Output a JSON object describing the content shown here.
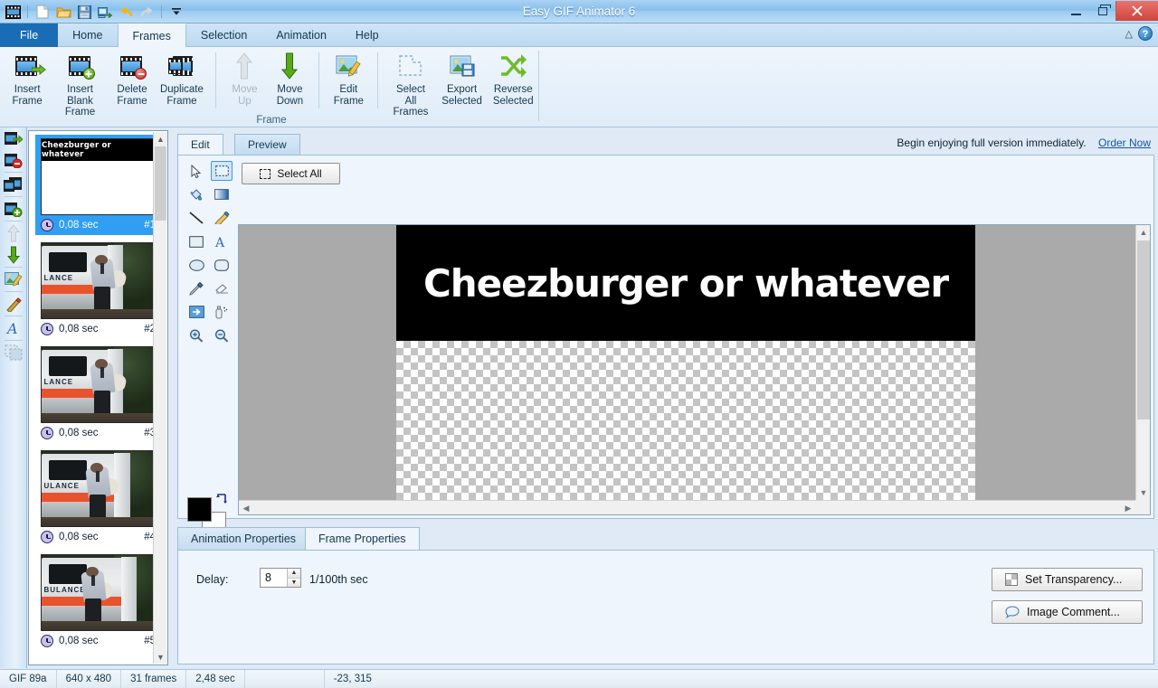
{
  "window": {
    "title": "Easy GIF Animator 6",
    "minimize_label": "Minimize",
    "maximize_label": "Restore",
    "close_label": "Close"
  },
  "quick_access": {
    "items": [
      {
        "name": "app-logo-icon",
        "label": "Easy GIF Animator"
      },
      {
        "name": "new-icon",
        "label": "New"
      },
      {
        "name": "open-icon",
        "label": "Open"
      },
      {
        "name": "save-icon",
        "label": "Save"
      },
      {
        "name": "export-icon",
        "label": "Export"
      },
      {
        "name": "undo-icon",
        "label": "Undo"
      },
      {
        "name": "redo-icon",
        "label": "Redo"
      },
      {
        "name": "customize-icon",
        "label": "Customize Quick Access Toolbar"
      }
    ]
  },
  "ribbon": {
    "tabs": [
      {
        "label": "File",
        "active": false,
        "is_file": true
      },
      {
        "label": "Home",
        "active": false
      },
      {
        "label": "Frames",
        "active": true
      },
      {
        "label": "Selection",
        "active": false
      },
      {
        "label": "Animation",
        "active": false
      },
      {
        "label": "Help",
        "active": false
      }
    ],
    "collapse_label": "Minimize the Ribbon",
    "help_label": "?",
    "group_title": "Frame",
    "buttons": [
      {
        "line1": "Insert",
        "line2": "Frame",
        "icon": "insert-frame-icon",
        "disabled": false
      },
      {
        "line1": "Insert Blank",
        "line2": "Frame",
        "icon": "insert-blank-frame-icon",
        "disabled": false
      },
      {
        "line1": "Delete",
        "line2": "Frame",
        "icon": "delete-frame-icon",
        "disabled": false
      },
      {
        "line1": "Duplicate",
        "line2": "Frame",
        "icon": "duplicate-frame-icon",
        "disabled": false
      },
      {
        "line1": "Move",
        "line2": "Up",
        "icon": "move-up-icon",
        "disabled": true
      },
      {
        "line1": "Move",
        "line2": "Down",
        "icon": "move-down-icon",
        "disabled": false
      },
      {
        "line1": "Edit",
        "line2": "Frame",
        "icon": "edit-frame-icon",
        "disabled": false
      },
      {
        "line1": "Select All",
        "line2": "Frames",
        "icon": "select-all-frames-icon",
        "disabled": false
      },
      {
        "line1": "Export",
        "line2": "Selected",
        "icon": "export-selected-icon",
        "disabled": false
      },
      {
        "line1": "Reverse",
        "line2": "Selected",
        "icon": "reverse-selected-icon",
        "disabled": false
      }
    ]
  },
  "side_toolbar": {
    "items": [
      {
        "name": "insert-frame-icon",
        "label": "Insert Frame"
      },
      {
        "name": "delete-frame-icon",
        "label": "Delete Frame"
      },
      {
        "name": "duplicate-frame-icon",
        "label": "Duplicate Frame"
      },
      {
        "name": "insert-blank-frame-icon",
        "label": "Insert Blank Frame"
      },
      {
        "name": "move-up-icon",
        "label": "Move Up"
      },
      {
        "name": "move-down-icon",
        "label": "Move Down"
      },
      {
        "name": "edit-frame-icon",
        "label": "Edit Frame"
      },
      {
        "name": "magic-wand-icon",
        "label": "Magic Wand"
      },
      {
        "name": "text-tool-icon",
        "label": "Add Text"
      },
      {
        "name": "select-all-frames-icon",
        "label": "Select All Frames"
      }
    ]
  },
  "frames": {
    "scroll_up_label": "Scroll up",
    "scroll_down_label": "Scroll down",
    "items": [
      {
        "delay": "0,08 sec",
        "number": "#1",
        "selected": true,
        "kind": "banner",
        "caption": "Cheezburger or whatever"
      },
      {
        "delay": "0,08 sec",
        "number": "#2",
        "selected": false,
        "kind": "photo",
        "caption": "LANCE"
      },
      {
        "delay": "0,08 sec",
        "number": "#3",
        "selected": false,
        "kind": "photo",
        "caption": "LANCE"
      },
      {
        "delay": "0,08 sec",
        "number": "#4",
        "selected": false,
        "kind": "photo",
        "caption": "ULANCE"
      },
      {
        "delay": "0,08 sec",
        "number": "#5",
        "selected": false,
        "kind": "photo",
        "caption": "BULANCE"
      }
    ]
  },
  "editor": {
    "tabs": [
      {
        "label": "Edit",
        "active": true
      },
      {
        "label": "Preview",
        "active": false
      }
    ],
    "promo_text": "Begin enjoying full version immediately.",
    "promo_link": "Order Now",
    "select_all_label": "Select All",
    "tools": [
      {
        "name": "pointer-tool-icon",
        "label": "Pointer",
        "selected": false
      },
      {
        "name": "rectangle-select-tool-icon",
        "label": "Rectangular Selection",
        "selected": true
      },
      {
        "name": "fill-tool-icon",
        "label": "Fill",
        "selected": false
      },
      {
        "name": "gradient-tool-icon",
        "label": "Gradient",
        "selected": false
      },
      {
        "name": "line-tool-icon",
        "label": "Line",
        "selected": false
      },
      {
        "name": "brush-tool-icon",
        "label": "Brush",
        "selected": false
      },
      {
        "name": "rectangle-tool-icon",
        "label": "Rectangle",
        "selected": false
      },
      {
        "name": "text-tool-icon",
        "label": "Text",
        "selected": false
      },
      {
        "name": "ellipse-tool-icon",
        "label": "Ellipse",
        "selected": false
      },
      {
        "name": "rounded-rectangle-tool-icon",
        "label": "Rounded Rectangle",
        "selected": false
      },
      {
        "name": "eyedropper-tool-icon",
        "label": "Color Picker",
        "selected": false
      },
      {
        "name": "eraser-tool-icon",
        "label": "Eraser",
        "selected": false
      },
      {
        "name": "image-insert-tool-icon",
        "label": "Insert Image",
        "selected": false
      },
      {
        "name": "spray-tool-icon",
        "label": "Airbrush",
        "selected": false
      },
      {
        "name": "zoom-in-tool-icon",
        "label": "Zoom In",
        "selected": false
      },
      {
        "name": "zoom-out-tool-icon",
        "label": "Zoom Out",
        "selected": false
      }
    ],
    "colors": {
      "foreground": "#000000",
      "background": "#ffffff",
      "swap_label": "Swap colors"
    },
    "canvas": {
      "banner_text": "Cheezburger or whatever",
      "banner_background": "#000000",
      "banner_text_color": "#ffffff",
      "workspace_background": "#aaaaaa"
    }
  },
  "properties": {
    "tabs": [
      {
        "label": "Animation Properties",
        "active": false
      },
      {
        "label": "Frame Properties",
        "active": true
      }
    ],
    "delay_label": "Delay:",
    "delay_value": "8",
    "delay_unit": "1/100th sec",
    "buttons": [
      {
        "label": "Set Transparency...",
        "icon": "transparency-icon"
      },
      {
        "label": "Image Comment...",
        "icon": "comment-icon"
      }
    ]
  },
  "status_bar": {
    "format": "GIF 89a",
    "dimensions": "640 x 480",
    "frame_count": "31 frames",
    "duration": "2,48 sec",
    "empty": "",
    "cursor": "-23,  315"
  }
}
